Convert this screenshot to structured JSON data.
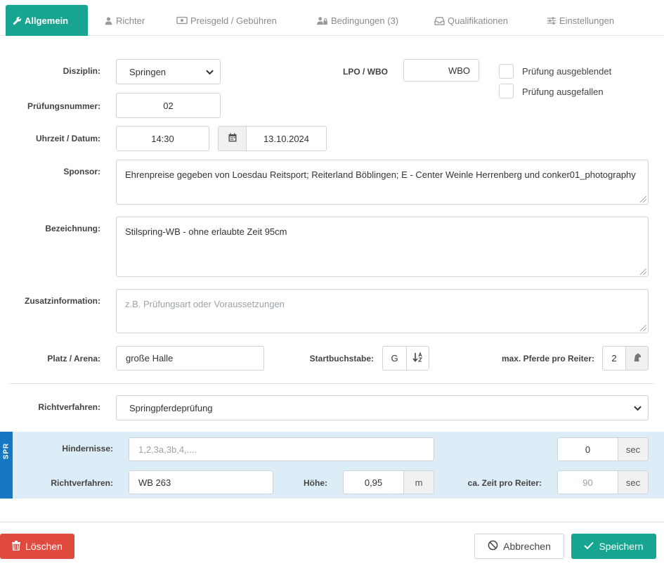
{
  "tabs": [
    {
      "label": "Allgemein",
      "icon": "wrench-icon",
      "active": true
    },
    {
      "label": "Richter",
      "icon": "user-icon"
    },
    {
      "label": "Preisgeld / Gebühren",
      "icon": "money-icon"
    },
    {
      "label": "Bedingungen (3)",
      "icon": "users-lock-icon"
    },
    {
      "label": "Qualifikationen",
      "icon": "inbox-icon"
    },
    {
      "label": "Einstellungen",
      "icon": "sliders-icon"
    }
  ],
  "form": {
    "disziplin": {
      "label": "Disziplin:",
      "value": "Springen"
    },
    "lpo_wbo": {
      "label": "LPO / WBO",
      "value": "WBO"
    },
    "pruefung_ausgeblendet": {
      "label": "Prüfung ausgeblendet",
      "checked": false
    },
    "pruefung_ausgefallen": {
      "label": "Prüfung ausgefallen",
      "checked": false
    },
    "pruefungsnummer": {
      "label": "Prüfungsnummer:",
      "value": "02"
    },
    "uhrzeit_datum": {
      "label": "Uhrzeit / Datum:",
      "time": "14:30",
      "date": "13.10.2024"
    },
    "sponsor": {
      "label": "Sponsor:",
      "value": "Ehrenpreise gegeben von Loesdau Reitsport; Reiterland Böblingen; E - Center Weinle Herrenberg und conker01_photography"
    },
    "bezeichnung": {
      "label": "Bezeichnung:",
      "value": "Stilspring-WB - ohne erlaubte Zeit 95cm"
    },
    "zusatzinformation": {
      "label": "Zusatzinformation:",
      "value": "",
      "placeholder": "z.B. Prüfungsart oder Voraussetzungen"
    },
    "platz_arena": {
      "label": "Platz / Arena:",
      "value": "große Halle"
    },
    "startbuchstabe": {
      "label": "Startbuchstabe:",
      "value": "G"
    },
    "max_pferde": {
      "label": "max. Pferde pro Reiter:",
      "value": "2"
    },
    "richtverfahren": {
      "label": "Richtverfahren:",
      "value": "Springpferdeprüfung"
    }
  },
  "spr": {
    "tag": "SPR",
    "hindernisse": {
      "label": "Hindernisse:",
      "value": "",
      "placeholder": "1,2,3a,3b,4,...."
    },
    "seconds": {
      "value": "0",
      "unit": "sec"
    },
    "richtverfahren": {
      "label": "Richtverfahren:",
      "value": "WB 263"
    },
    "hoehe": {
      "label": "Höhe:",
      "value": "0,95",
      "unit": "m"
    },
    "zeit_pro_reiter": {
      "label": "ca. Zeit pro Reiter:",
      "value": "",
      "placeholder": "90",
      "unit": "sec"
    }
  },
  "buttons": {
    "delete": "Löschen",
    "cancel": "Abbrechen",
    "save": "Speichern"
  },
  "colors": {
    "accent": "#17a592",
    "danger": "#e14b3f",
    "spr_tag": "#1678c2",
    "spr_panel": "#ddedf7"
  }
}
